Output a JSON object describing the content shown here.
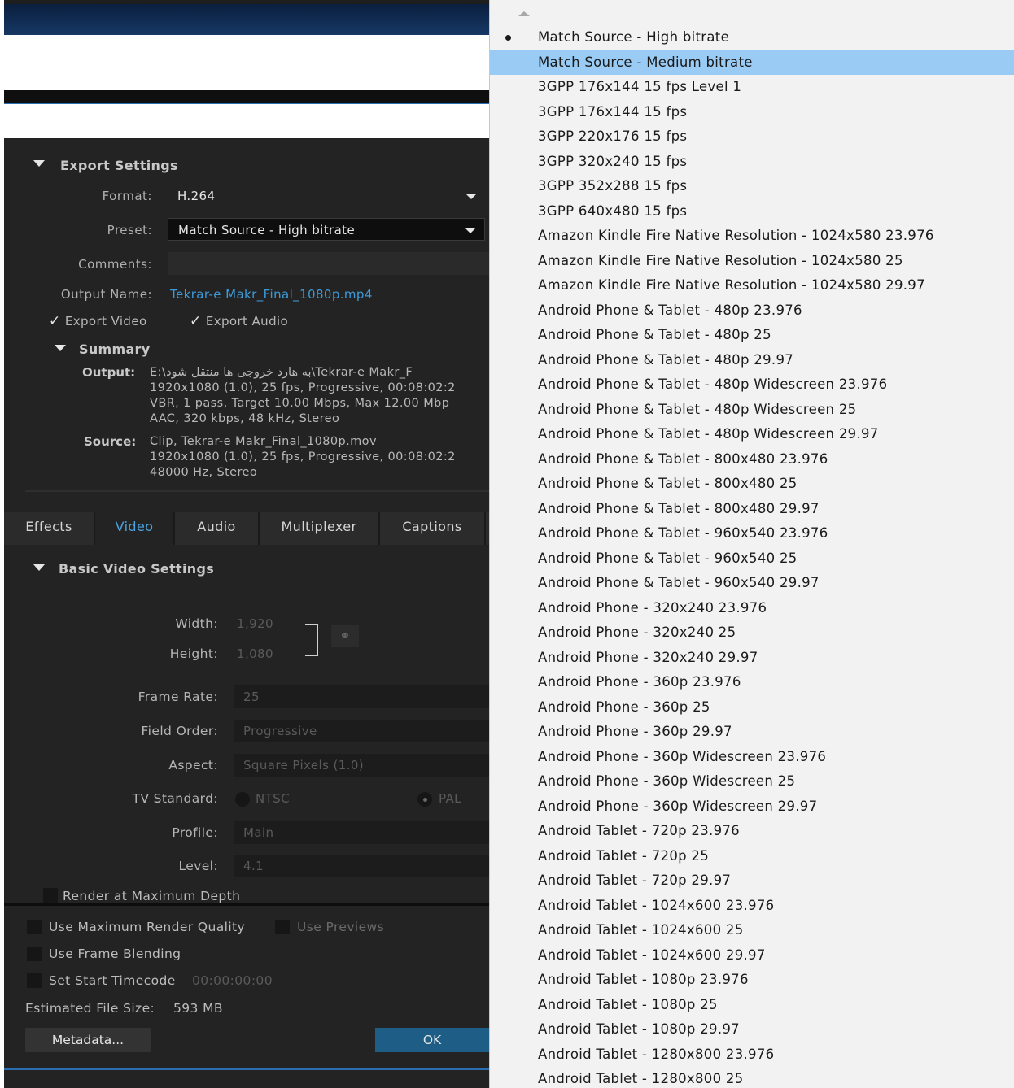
{
  "export_settings": {
    "title": "Export Settings",
    "format_label": "Format:",
    "format_value": "H.264",
    "preset_label": "Preset:",
    "preset_value": "Match Source - High bitrate",
    "comments_label": "Comments:",
    "comments_value": "",
    "output_name_label": "Output Name:",
    "output_name_value": "Tekrar-e Makr_Final_1080p.mp4",
    "export_video_label": "Export Video",
    "export_audio_label": "Export Audio",
    "export_video_checked": true,
    "export_audio_checked": true
  },
  "summary": {
    "title": "Summary",
    "output_label": "Output:",
    "output_line1": "E:\\به هارد خروجی ها منتقل شود\\Tekrar-e Makr_F",
    "output_line2": "1920x1080 (1.0), 25 fps, Progressive, 00:08:02:2",
    "output_line3": "VBR, 1 pass, Target 10.00 Mbps, Max 12.00 Mbp",
    "output_line4": "AAC, 320 kbps, 48 kHz, Stereo",
    "source_label": "Source:",
    "source_line1": "Clip, Tekrar-e Makr_Final_1080p.mov",
    "source_line2": "1920x1080 (1.0), 25 fps, Progressive, 00:08:02:2",
    "source_line3": "48000 Hz, Stereo"
  },
  "tabs": [
    {
      "label": "Effects",
      "active": false
    },
    {
      "label": "Video",
      "active": true
    },
    {
      "label": "Audio",
      "active": false
    },
    {
      "label": "Multiplexer",
      "active": false
    },
    {
      "label": "Captions",
      "active": false
    }
  ],
  "video": {
    "section_title": "Basic Video Settings",
    "width_label": "Width:",
    "width_value": "1,920",
    "height_label": "Height:",
    "height_value": "1,080",
    "frame_rate_label": "Frame Rate:",
    "frame_rate_value": "25",
    "field_order_label": "Field Order:",
    "field_order_value": "Progressive",
    "aspect_label": "Aspect:",
    "aspect_value": "Square Pixels (1.0)",
    "tv_standard_label": "TV Standard:",
    "ntsc_label": "NTSC",
    "pal_label": "PAL",
    "tv_standard_selected": "PAL",
    "profile_label": "Profile:",
    "profile_value": "Main",
    "level_label": "Level:",
    "level_value": "4.1",
    "render_max_depth_label": "Render at Maximum Depth"
  },
  "bottom": {
    "max_render_quality_label": "Use Maximum Render Quality",
    "use_previews_label": "Use Previews",
    "frame_blending_label": "Use Frame Blending",
    "start_timecode_label": "Set Start Timecode",
    "start_timecode_value": "00:00:00:00",
    "estimated_size_label": "Estimated File Size:",
    "estimated_size_value": "593 MB",
    "metadata_button": "Metadata...",
    "ok_button": "OK"
  },
  "preset_list": {
    "selected_index": 0,
    "highlighted_index": 1,
    "items": [
      "Match Source - High bitrate",
      "Match Source - Medium bitrate",
      "3GPP 176x144 15 fps Level 1",
      "3GPP 176x144 15 fps",
      "3GPP 220x176 15 fps",
      "3GPP 320x240 15 fps",
      "3GPP 352x288 15 fps",
      "3GPP 640x480 15 fps",
      "Amazon Kindle Fire Native Resolution - 1024x580 23.976",
      "Amazon Kindle Fire Native Resolution - 1024x580 25",
      "Amazon Kindle Fire Native Resolution - 1024x580 29.97",
      "Android Phone & Tablet - 480p 23.976",
      "Android Phone & Tablet - 480p 25",
      "Android Phone & Tablet - 480p 29.97",
      "Android Phone & Tablet - 480p Widescreen 23.976",
      "Android Phone & Tablet - 480p Widescreen 25",
      "Android Phone & Tablet - 480p Widescreen 29.97",
      "Android Phone & Tablet - 800x480 23.976",
      "Android Phone & Tablet - 800x480 25",
      "Android Phone & Tablet - 800x480 29.97",
      "Android Phone & Tablet - 960x540 23.976",
      "Android Phone & Tablet - 960x540 25",
      "Android Phone & Tablet - 960x540 29.97",
      "Android Phone - 320x240 23.976",
      "Android Phone - 320x240 25",
      "Android Phone - 320x240 29.97",
      "Android Phone - 360p 23.976",
      "Android Phone - 360p 25",
      "Android Phone - 360p 29.97",
      "Android Phone - 360p Widescreen 23.976",
      "Android Phone - 360p Widescreen 25",
      "Android Phone - 360p Widescreen 29.97",
      "Android Tablet - 720p 23.976",
      "Android Tablet - 720p 25",
      "Android Tablet - 720p 29.97",
      "Android Tablet - 1024x600 23.976",
      "Android Tablet - 1024x600 25",
      "Android Tablet - 1024x600 29.97",
      "Android Tablet - 1080p 23.976",
      "Android Tablet - 1080p 25",
      "Android Tablet - 1080p 29.97",
      "Android Tablet - 1280x800 23.976",
      "Android Tablet - 1280x800 25"
    ]
  }
}
